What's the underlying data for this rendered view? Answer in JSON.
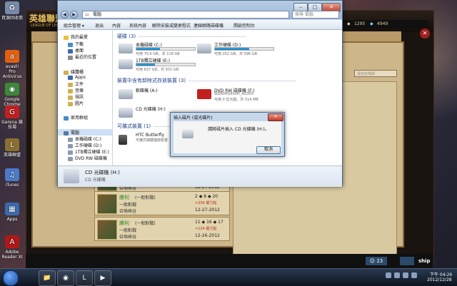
{
  "desktop": {
    "icons": [
      {
        "label": "資源回收筒",
        "color": "#7a8aa8",
        "glyph": "♻"
      },
      {
        "label": "avast! Pro Antivirus",
        "color": "#e06010",
        "glyph": "a"
      },
      {
        "label": "Google Chrome",
        "color": "#3a8a3a",
        "glyph": "◉"
      },
      {
        "label": "Garena 競技場",
        "color": "#c02020",
        "glyph": "G"
      },
      {
        "label": "英雄聯盟",
        "color": "#8a7030",
        "glyph": "L"
      },
      {
        "label": "iTunes",
        "color": "#4a7ac8",
        "glyph": "♫"
      },
      {
        "label": "Apps",
        "color": "#3a6ab0",
        "glyph": "▦"
      },
      {
        "label": "Adobe Reader XI",
        "color": "#b01818",
        "glyph": "A"
      }
    ]
  },
  "lol": {
    "logo": "英雄聯盟",
    "logo_sub": "LEAGUE OF LEGENDS",
    "ip": "1295",
    "rp": "4949",
    "search_placeholder": "尋找召喚師",
    "matches": [
      {
        "result": "",
        "mode": "",
        "l2": "",
        "l3": "召喚峽谷",
        "kda": "",
        "gold": "",
        "date": "12-27-2012"
      },
      {
        "result": "勝利",
        "mode": "(一般對戰)",
        "l2": "一般對戰",
        "l3": "召喚峽谷",
        "kda": "2 ◆ 8 ◆ 20",
        "gold": "+256 權力點",
        "date": "12-27-2012"
      },
      {
        "result": "勝利",
        "mode": "(一般對戰)",
        "l2": "一般對戰",
        "l3": "召喚峽谷",
        "kda": "11 ◆ 16 ◆ 17",
        "gold": "+124 權力點",
        "date": "12-26-2012"
      }
    ],
    "ship_label": "ship",
    "people_count": "23"
  },
  "explorer": {
    "address": "電腦",
    "search_placeholder": "搜尋 電腦",
    "toolbar": [
      "組合管理 ▾",
      "退出",
      "內容",
      "系統內容",
      "解除安裝或變更程式",
      "連線網路磁碟機",
      "開啟控制台"
    ],
    "nav": [
      {
        "label": "我的最愛",
        "color": "#e8c040"
      },
      {
        "label": "下載",
        "color": "#4a8ad0"
      },
      {
        "label": "桌面",
        "color": "#3a6ab0"
      },
      {
        "label": "最近的位置",
        "color": "#8a8a8a"
      },
      {
        "label": "媒體櫃",
        "color": "#d0b050"
      },
      {
        "label": "Apps",
        "color": "#3a6ab0"
      },
      {
        "label": "文件",
        "color": "#d0b050"
      },
      {
        "label": "音樂",
        "color": "#d0b050"
      },
      {
        "label": "視訊",
        "color": "#d0b050"
      },
      {
        "label": "圖片",
        "color": "#d0b050"
      },
      {
        "label": "家用群組",
        "color": "#4a8ad0"
      },
      {
        "label": "電腦",
        "color": "#5a7aa0"
      },
      {
        "label": "本機磁碟 (C:)",
        "color": "#8a9ab0"
      },
      {
        "label": "工作硬碟 (D:)",
        "color": "#8a9ab0"
      },
      {
        "label": "1TB獨立硬碟 (E:)",
        "color": "#8a9ab0"
      },
      {
        "label": "DVD RW 磁碟機",
        "color": "#8a9ab0"
      }
    ],
    "groups": {
      "hdd": "硬碟 (3)",
      "removable": "裝置中含有卸除式存放裝置 (3)",
      "portable": "可攜式裝置 (1)"
    },
    "drives": [
      {
        "name": "本機磁碟 (C:)",
        "size": "可用 70.6 GB，共 118 GB",
        "fill": 0.4
      },
      {
        "name": "工作硬碟 (D:)",
        "size": "可用 252 GB，共 596 GB",
        "fill": 0.58
      },
      {
        "name": "1TB獨立硬碟 (E:)",
        "size": "可用 637 GB，共 931 GB",
        "fill": 0.32
      }
    ],
    "removable": [
      {
        "name": "軟碟機 (A:)",
        "sub": ""
      },
      {
        "name": "DVD RW 磁碟機 (F:)",
        "sub": "WZRHPG450H_AU350"
      },
      {
        "name": "CD 光碟機 (H:)",
        "sub": ""
      }
    ],
    "dvd_extra": "可用 0 位元組，共 514 MB",
    "portable": {
      "name": "HTC Butterfly",
      "sub": "可攜式媒體播放裝置"
    },
    "details": {
      "name": "CD 光碟機 (H:)",
      "type": "CD 光碟機"
    }
  },
  "dialog": {
    "title": "插入磁片 (或光碟片)",
    "message": "請將磁片插入 CD 光碟機 (H:)。",
    "cancel": "取消"
  },
  "taskbar": {
    "time": "下午 04:26",
    "date": "2012/12/28",
    "apps": [
      "📁",
      "◉",
      "L",
      "▶"
    ]
  }
}
